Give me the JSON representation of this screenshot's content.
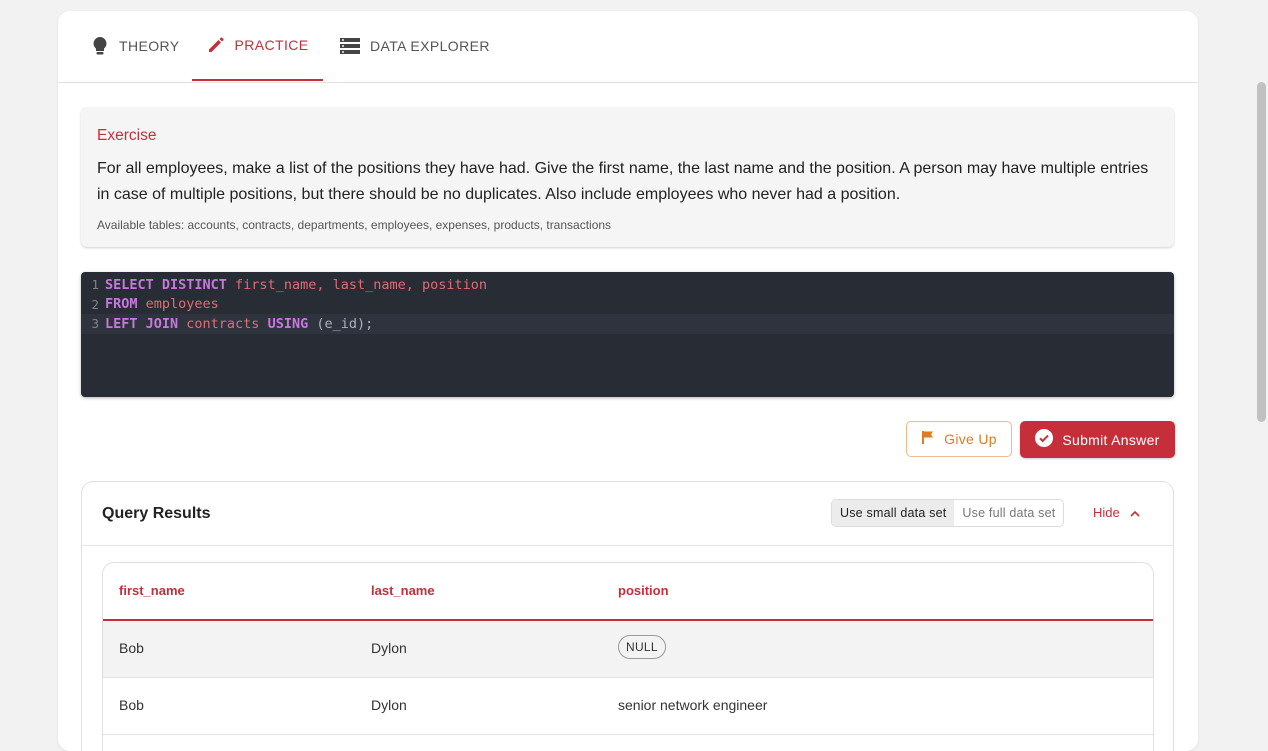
{
  "tabs": {
    "theory": "THEORY",
    "practice": "PRACTICE",
    "data_explorer": "DATA EXPLORER"
  },
  "exercise": {
    "title": "Exercise",
    "text": "For all employees, make a list of the positions they have had. Give the first name, the last name and the position. A person may have multiple entries in case of multiple positions, but there should be no duplicates. Also include employees who never had a position.",
    "tables": "Available tables: accounts, contracts, departments, employees, expenses, products, transactions"
  },
  "editor": {
    "lines": [
      {
        "num": "1",
        "kw1": "SELECT DISTINCT",
        "rest": " first_name, last_name, position"
      },
      {
        "num": "2",
        "kw1": "FROM",
        "rest": " employees"
      },
      {
        "num": "3",
        "kw1": "LEFT JOIN",
        "mid": " contracts ",
        "kw2": "USING",
        "rest": " (e_id);"
      }
    ]
  },
  "actions": {
    "give_up": "Give Up",
    "submit": "Submit Answer"
  },
  "results": {
    "title": "Query Results",
    "small_data": "Use small data set",
    "full_data": "Use full data set",
    "hide": "Hide",
    "columns": [
      "first_name",
      "last_name",
      "position"
    ],
    "rows": [
      {
        "first_name": "Bob",
        "last_name": "Dylon",
        "position": "NULL"
      },
      {
        "first_name": "Bob",
        "last_name": "Dylon",
        "position": "senior network engineer"
      }
    ]
  },
  "colors": {
    "accent": "#c62f3a",
    "warning": "#e07b24",
    "editor_bg": "#282c34"
  }
}
